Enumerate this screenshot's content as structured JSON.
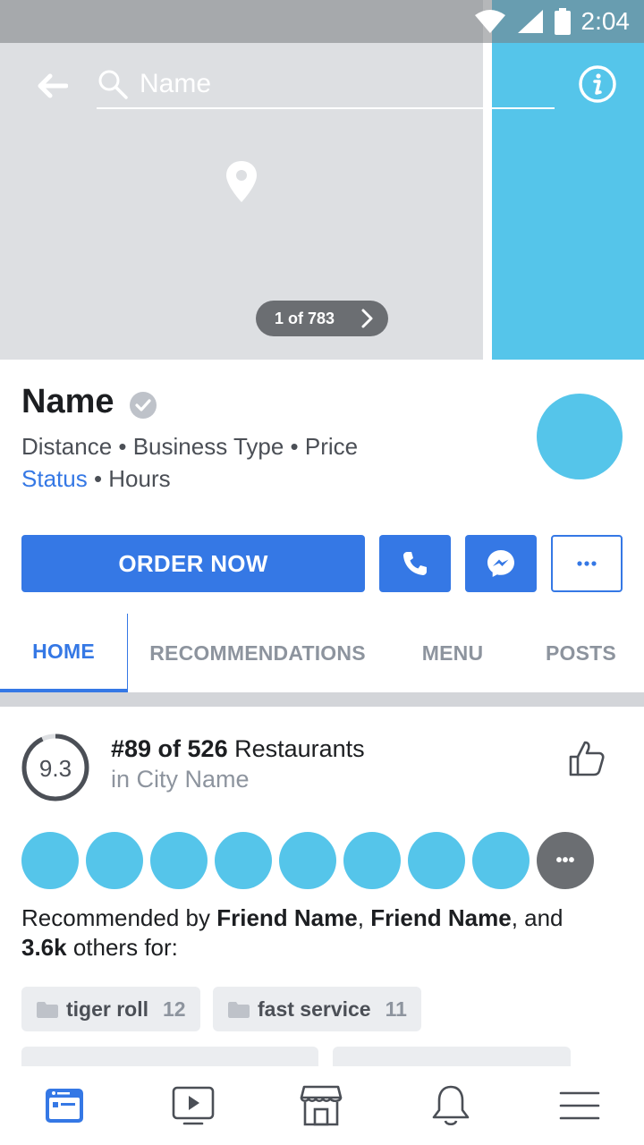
{
  "status_bar": {
    "time": "2:04"
  },
  "header": {
    "search_placeholder": "Name",
    "pager_label": "1 of 783"
  },
  "profile": {
    "name": "Name",
    "meta": "Distance • Business Type • Price",
    "status": "Status",
    "hours": "• Hours"
  },
  "actions": {
    "order_label": "ORDER NOW",
    "more_label": "•••"
  },
  "tabs": [
    {
      "label": "HOME",
      "active": true
    },
    {
      "label": "RECOMMENDATIONS",
      "active": false
    },
    {
      "label": "MENU",
      "active": false
    },
    {
      "label": "POSTS",
      "active": false
    }
  ],
  "ranking": {
    "score": "9.3",
    "rank": "#89 of 526",
    "category": "Restaurants",
    "location": "in City Name"
  },
  "recommenders": {
    "more_label": "•••",
    "text_prefix": "Recommended by ",
    "friend1": "Friend Name",
    "separator": ", ",
    "friend2": "Friend Name",
    "and": ", and",
    "count": "3.6k",
    "suffix": " others for:"
  },
  "tags": [
    {
      "label": "tiger roll",
      "count": "12"
    },
    {
      "label": "fast service",
      "count": "11"
    }
  ],
  "colors": {
    "brand_blue": "#3578e5",
    "accent_cyan": "#55c5ea",
    "muted_gray": "#8d949e"
  },
  "bottom_nav": [
    "feed-icon",
    "video-icon",
    "marketplace-icon",
    "bell-icon",
    "menu-icon"
  ]
}
